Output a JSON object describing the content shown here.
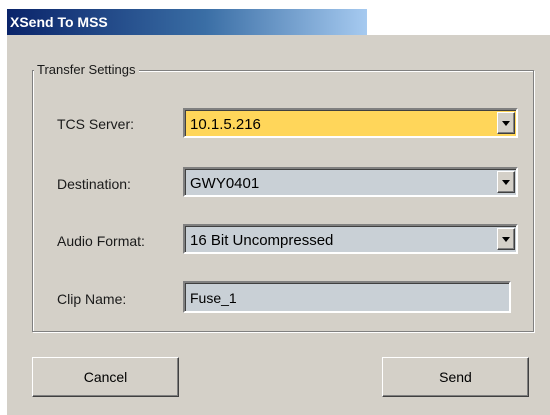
{
  "window": {
    "title": "XSend To MSS"
  },
  "group": {
    "title": "Transfer Settings"
  },
  "fields": {
    "tcs_server": {
      "label": "TCS Server:",
      "value": "10.1.5.216"
    },
    "destination": {
      "label": "Destination:",
      "value": "GWY0401"
    },
    "audio_format": {
      "label": "Audio Format:",
      "value": "16 Bit Uncompressed"
    },
    "clip_name": {
      "label": "Clip Name:",
      "value": "Fuse_1"
    }
  },
  "buttons": {
    "cancel": "Cancel",
    "send": "Send"
  },
  "colors": {
    "title_bar_start": "#0a246a",
    "title_bar_end": "#a6caf0",
    "panel_background": "#d4d0c8",
    "highlighted_field": "#ffd65a",
    "field_background": "#c9d0d6"
  },
  "icons": {
    "dropdown": "chevron-down-icon"
  }
}
